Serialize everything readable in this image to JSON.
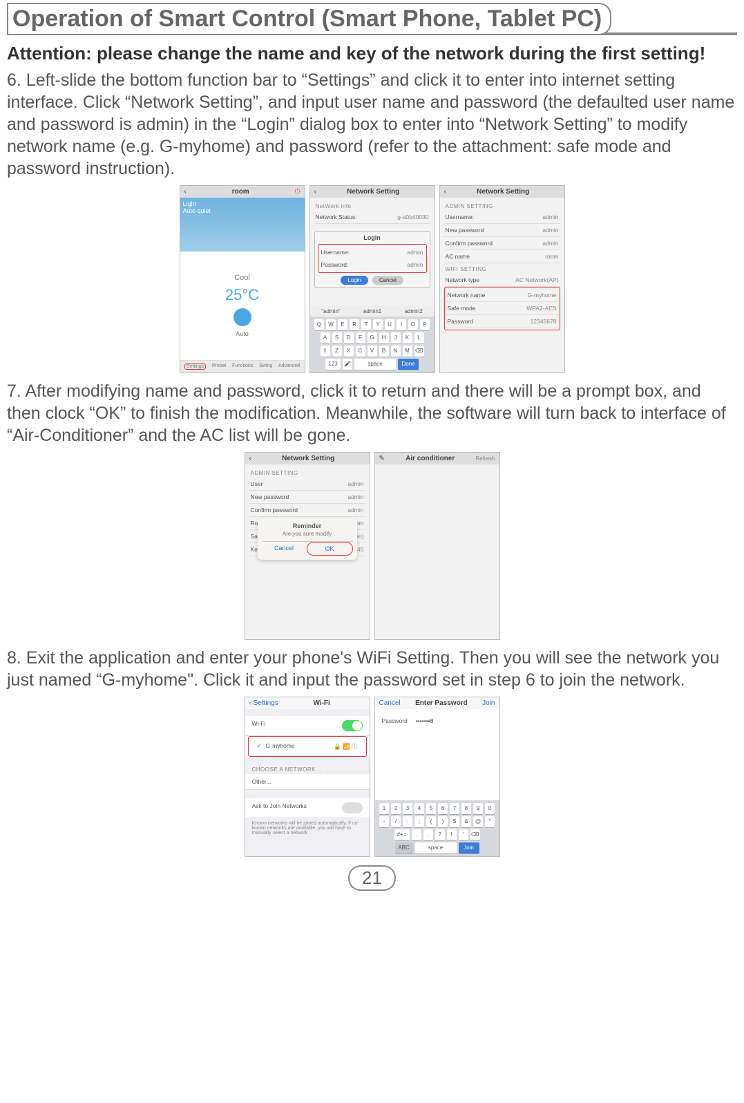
{
  "page_title": "Operation of Smart Control (Smart Phone, Tablet PC)",
  "attention": "Attention: please change the name and key of the network during the first setting!",
  "step6": "6. Left-slide the bottom function bar to “Settings” and click it to enter into internet setting interface. Click “Network Setting”, and input user name and password (the defaulted user name and password is admin) in the “Login” dialog box to enter into “Network Setting” to modify network name (e.g. G-myhome) and password (refer to the attachment: safe mode and password instruction).",
  "step7": "7. After modifying name and password, click it to return and there will be a prompt box, and then clock “OK” to finish the modification. Meanwhile, the software will turn back to interface of “Air-Conditioner” and the AC list will be gone.",
  "step8": "8. Exit the application and enter your phone's WiFi Setting. Then you will see the network you just named “G-myhome\". Click it and input the password set in step 6 to join the network.",
  "page_number": "21",
  "room_screen": {
    "title": "room",
    "modes": [
      "Light",
      "Auto quiet"
    ],
    "mode_label": "Cool",
    "temp": "25°C",
    "auto": "Auto",
    "fn": [
      "Settings",
      "Preset",
      "Functions",
      "Swing",
      "Advanced"
    ]
  },
  "login_screen": {
    "title": "Network Setting",
    "info_header": "NetWork info",
    "status_label": "Network Status:",
    "status_value": "g-a0b40030",
    "dialog_title": "Login",
    "user_label": "Username:",
    "user_value": "admin",
    "pass_label": "Password:",
    "pass_value": "admin",
    "login_btn": "Login",
    "cancel_btn": "Cancel",
    "suggest": [
      "\"admin\"",
      "admin1",
      "admin2"
    ],
    "krow1": [
      "Q",
      "W",
      "E",
      "R",
      "T",
      "Y",
      "U",
      "I",
      "O",
      "P"
    ],
    "krow2": [
      "A",
      "S",
      "D",
      "F",
      "G",
      "H",
      "J",
      "K",
      "L"
    ],
    "krow3": [
      "Z",
      "X",
      "C",
      "V",
      "B",
      "N",
      "M"
    ],
    "k123": "123",
    "space": "space",
    "done": "Done"
  },
  "netset_screen": {
    "title": "Network Setting",
    "admin_section": "ADMIN SETTING",
    "user_l": "Username:",
    "user_v": "admin",
    "npass_l": "New password",
    "npass_v": "admin",
    "cpass_l": "Confirm password",
    "cpass_v": "admin",
    "ac_l": "AC name",
    "ac_v": "room",
    "wifi_section": "WIFI SETTING",
    "ntype_l": "Network type",
    "ntype_v": "AC Network(AP)",
    "nname_l": "Network name",
    "nname_v": "G-myhome",
    "safe_l": "Safe mode",
    "safe_v": "WPA2-AES",
    "pw_l": "Password",
    "pw_v": "12345678"
  },
  "confirm_screen": {
    "title": "Network Setting",
    "sect": "ADMIN SETTING",
    "user_l": "User",
    "user_v": "admin",
    "npass_l": "New password",
    "npass_v": "admin",
    "cpass_l": "Confirm password",
    "cpass_v": "admin",
    "room_l": "Room name",
    "room_v": "Bedroom",
    "safe_l": "Safe mode",
    "safe_v": "WEP64(Open)",
    "key_l": "Key",
    "key_v": "12345",
    "rem_title": "Reminder",
    "rem_text": "Are you sure modify",
    "cancel": "Cancel",
    "ok": "OK"
  },
  "aclist_screen": {
    "title": "Air conditioner",
    "refresh": "Refresh"
  },
  "wifi_screen": {
    "back": "Settings",
    "title": "Wi-Fi",
    "wifi_label": "Wi-Fi",
    "net_name": "G-myhome",
    "choose": "CHOOSE A NETWORK...",
    "other": "Other...",
    "ask": "Ask to Join Networks",
    "ask_note": "Known networks will be joined automatically. If no known networks are available, you will have to manually select a network."
  },
  "enterpw_screen": {
    "cancel": "Cancel",
    "title": "Enter Password",
    "join": "Join",
    "pw_label": "Password",
    "pw_value": "•••••••8",
    "krow1": [
      "1",
      "2",
      "3",
      "4",
      "5",
      "6",
      "7",
      "8",
      "9",
      "0"
    ],
    "krow2": [
      "-",
      "/",
      ":",
      ";",
      "(",
      ")",
      "$",
      "&",
      "@",
      "\""
    ],
    "krow3": [
      ".",
      ",",
      "?",
      "!",
      "'"
    ],
    "abc": "ABC",
    "space": "space",
    "joinbtn": "Join"
  }
}
